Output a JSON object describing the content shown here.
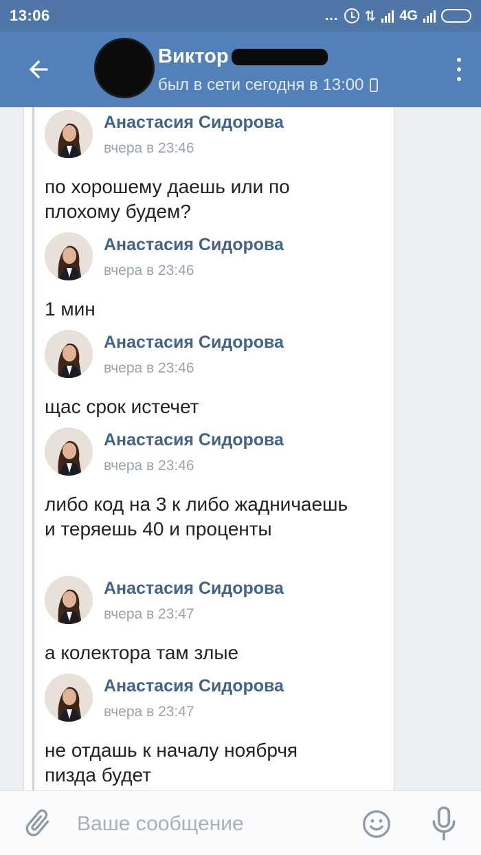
{
  "status_bar": {
    "time": "13:06",
    "dots": "...",
    "network": "4G"
  },
  "header": {
    "name": "Виктор",
    "status": "был в сети сегодня в 13:00"
  },
  "messages": [
    {
      "author": "Анастасия Сидорова",
      "time": "вчера в 23:46",
      "text": "по хорошему даешь или по плохому будем?"
    },
    {
      "author": "Анастасия Сидорова",
      "time": "вчера в 23:46",
      "text": "1 мин"
    },
    {
      "author": "Анастасия Сидорова",
      "time": "вчера в 23:46",
      "text": "щас срок истечет"
    },
    {
      "author": "Анастасия Сидорова",
      "time": "вчера в 23:46",
      "text": "либо код на 3 к либо жадничаешь и теряешь 40 и проценты"
    },
    {
      "author": "Анастасия Сидорова",
      "time": "вчера в 23:47",
      "text": "а колектора там злые"
    },
    {
      "author": "Анастасия Сидорова",
      "time": "вчера в 23:47",
      "text": "не отдашь к началу ноябрчя пизда будет"
    }
  ],
  "input": {
    "placeholder": "Ваше сообщение"
  },
  "colors": {
    "header_bg": "#5181b8",
    "status_bar_bg": "#4f76a6",
    "author_link": "#42648b",
    "chat_bg": "#ebeef2"
  }
}
